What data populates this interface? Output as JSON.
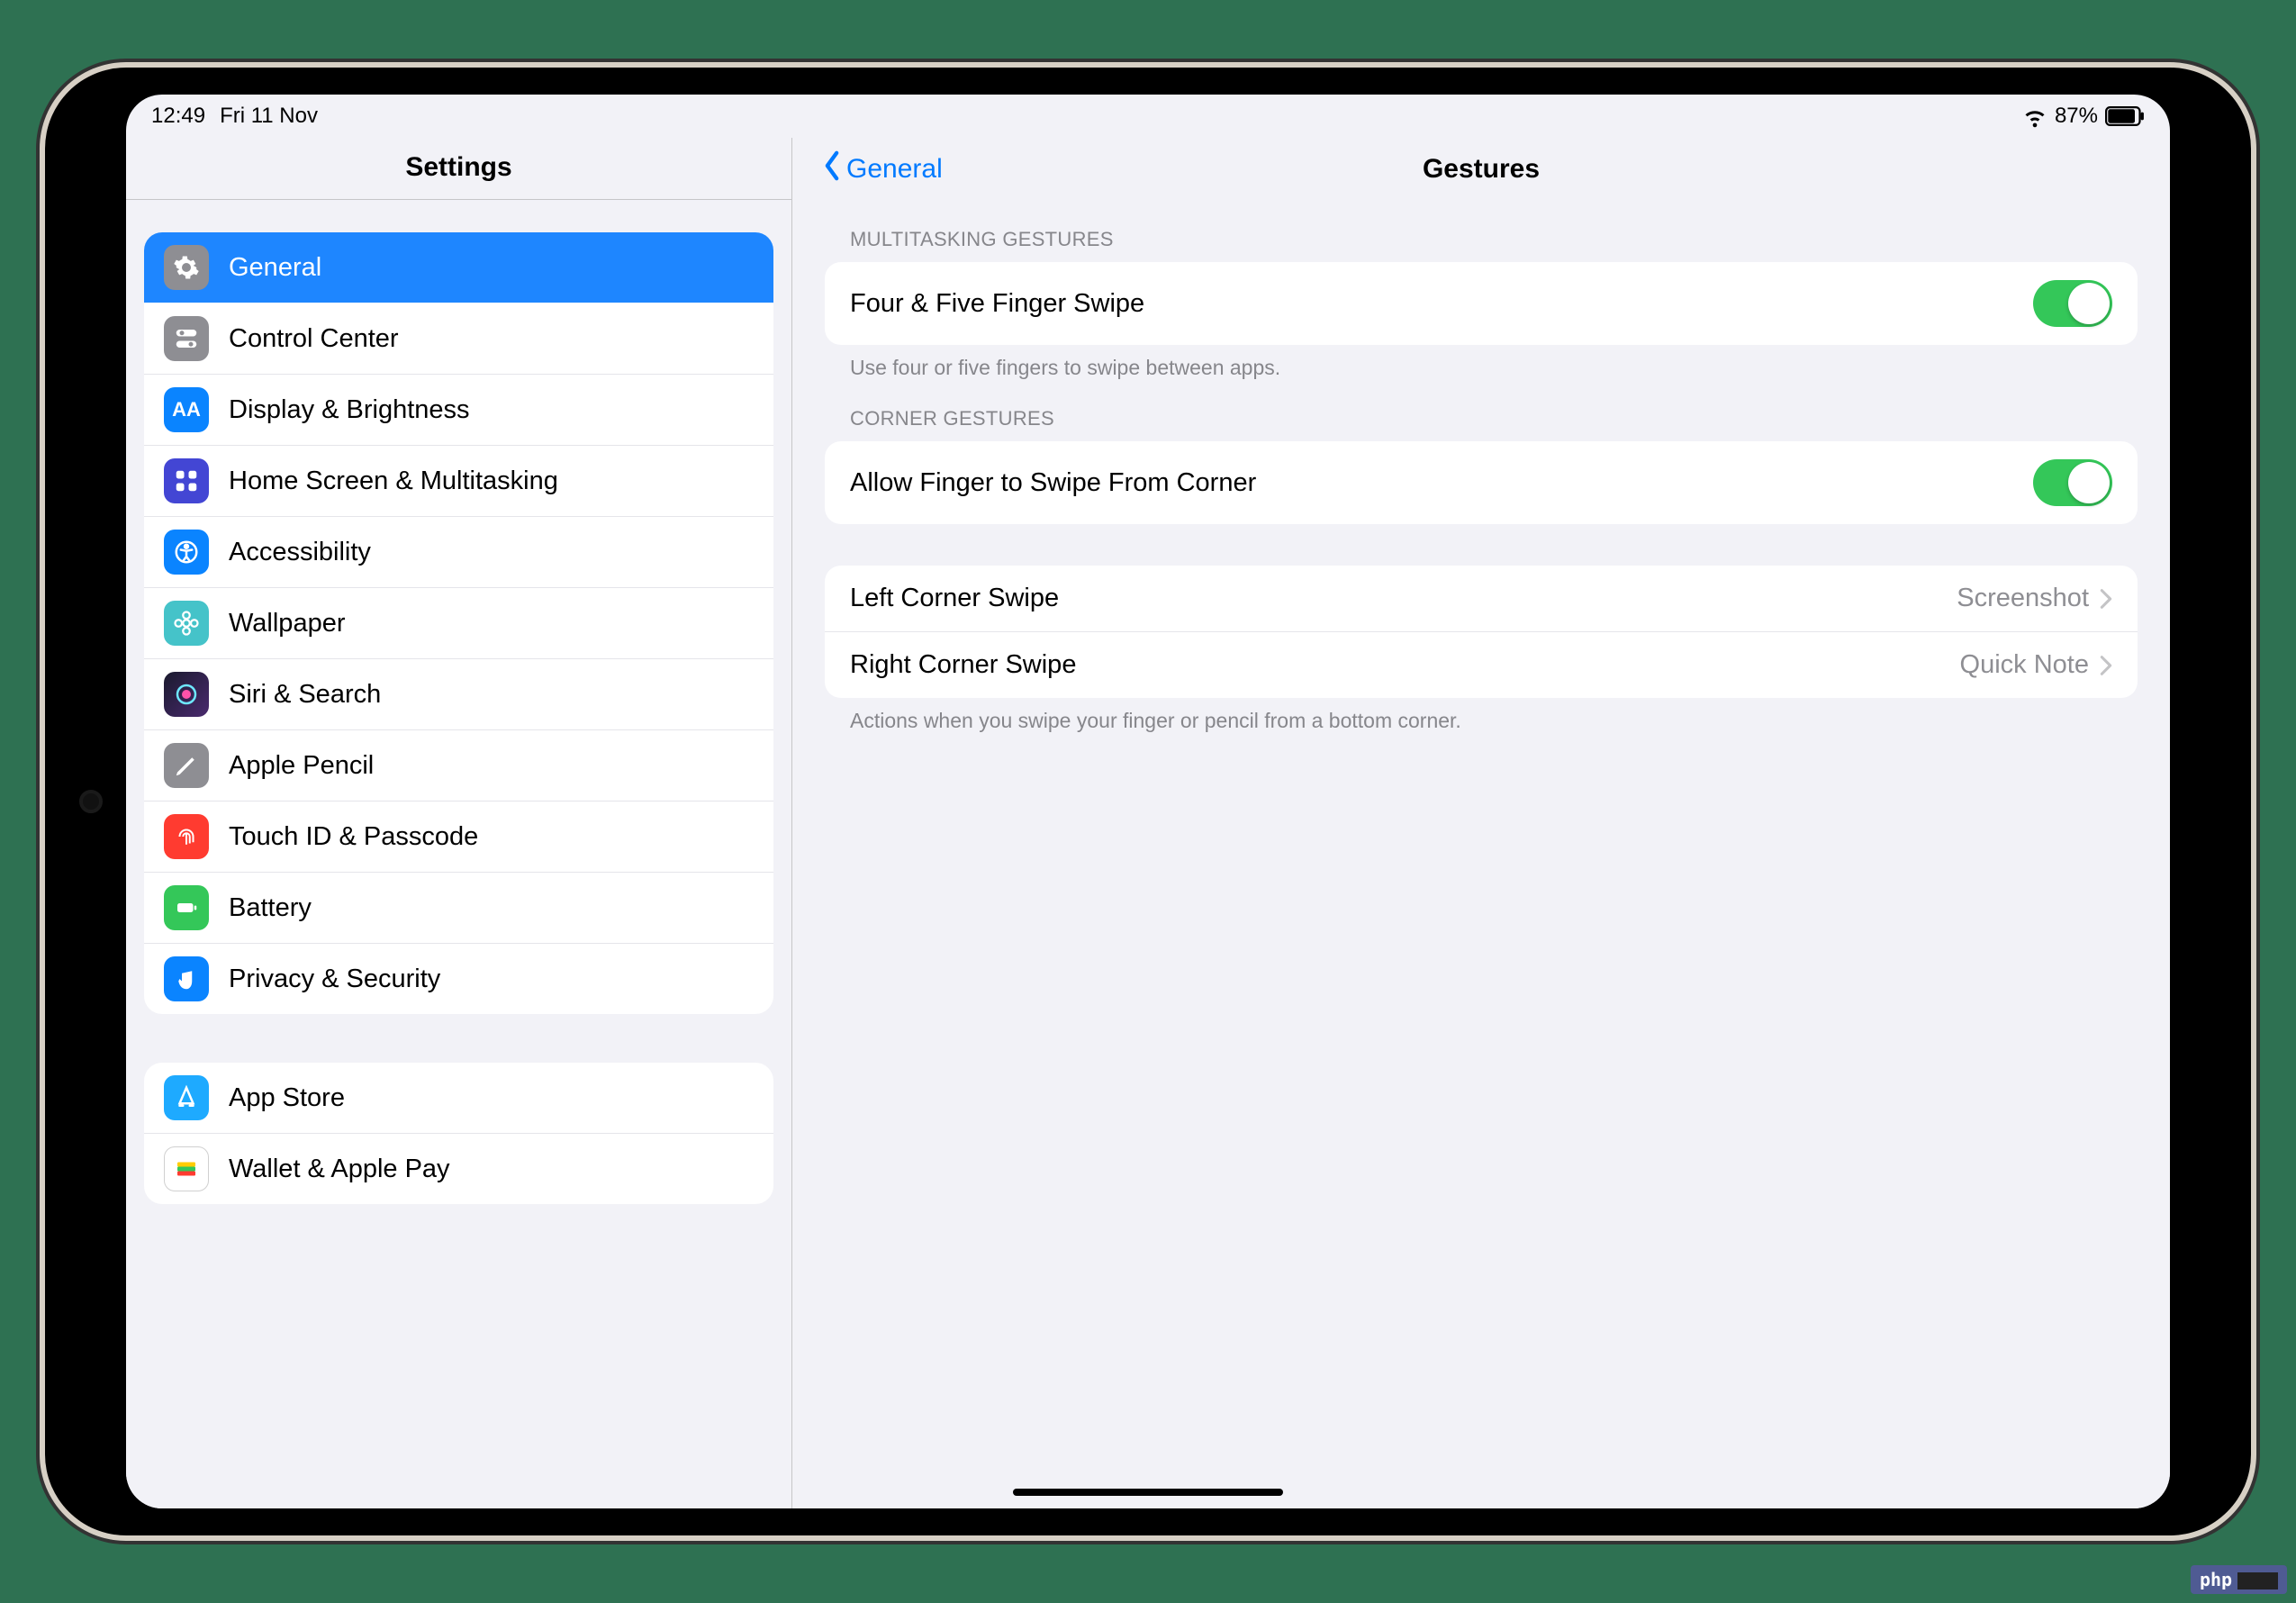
{
  "status": {
    "time": "12:49",
    "date": "Fri 11 Nov",
    "battery_pct": "87%"
  },
  "sidebar": {
    "title": "Settings",
    "group1": [
      {
        "label": "General"
      },
      {
        "label": "Control Center"
      },
      {
        "label": "Display & Brightness"
      },
      {
        "label": "Home Screen & Multitasking"
      },
      {
        "label": "Accessibility"
      },
      {
        "label": "Wallpaper"
      },
      {
        "label": "Siri & Search"
      },
      {
        "label": "Apple Pencil"
      },
      {
        "label": "Touch ID & Passcode"
      },
      {
        "label": "Battery"
      },
      {
        "label": "Privacy & Security"
      }
    ],
    "group2": [
      {
        "label": "App Store"
      },
      {
        "label": "Wallet & Apple Pay"
      }
    ]
  },
  "detail": {
    "back_label": "General",
    "title": "Gestures",
    "multitasking": {
      "header": "MULTITASKING GESTURES",
      "row_label": "Four & Five Finger Swipe",
      "toggle_on": true,
      "footer": "Use four or five fingers to swipe between apps."
    },
    "corner": {
      "header": "CORNER GESTURES",
      "row_label": "Allow Finger to Swipe From Corner",
      "toggle_on": true
    },
    "actions": {
      "left_label": "Left Corner Swipe",
      "left_value": "Screenshot",
      "right_label": "Right Corner Swipe",
      "right_value": "Quick Note",
      "footer": "Actions when you swipe your finger or pencil from a bottom corner."
    }
  },
  "badge": {
    "text": "php"
  }
}
